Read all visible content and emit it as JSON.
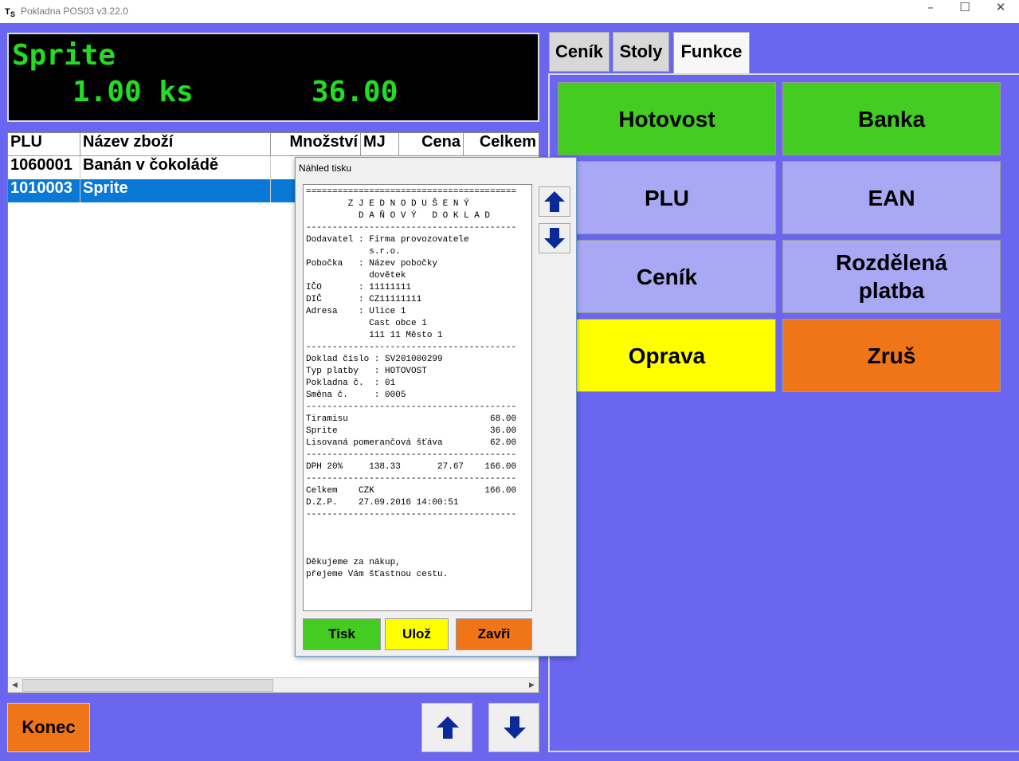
{
  "window": {
    "title": "Pokladna POS03 v3.22.0",
    "icon": "app-icon"
  },
  "display": {
    "item": "Sprite",
    "quantity": "1.00 ks",
    "price": "36.00"
  },
  "table": {
    "columns": [
      "PLU",
      "Název zboží",
      "Množství",
      "MJ",
      "Cena",
      "Celkem"
    ],
    "rows": [
      [
        "1060001",
        "Banán v čokoládě",
        "",
        "",
        "",
        ""
      ],
      [
        "1010003",
        "Sprite",
        "",
        "",
        "",
        ""
      ]
    ],
    "selected_row": 1
  },
  "buttons": {
    "konec": "Konec",
    "up_icon": "arrow-up-icon",
    "down_icon": "arrow-down-icon"
  },
  "tabs": [
    "Ceník",
    "Stoly",
    "Funkce"
  ],
  "active_tab": "Funkce",
  "functions": [
    {
      "label": "Hotovost",
      "color": "#44cc22"
    },
    {
      "label": "Banka",
      "color": "#44cc22"
    },
    {
      "label": "PLU",
      "color": "#a8a8f5"
    },
    {
      "label": "EAN",
      "color": "#a8a8f5"
    },
    {
      "label": "Ceník",
      "color": "#a8a8f5"
    },
    {
      "label": "Rozdělená platba",
      "color": "#a8a8f5"
    },
    {
      "label": "Oprava",
      "color": "#ffff00"
    },
    {
      "label": "Zruš",
      "color": "#f07518"
    }
  ],
  "dialog": {
    "title": "Náhled tisku",
    "receipt": "========================================\n        Z J E D N O D U Š E N Ý\n          D A Ň O V Ý   D O K L A D\n----------------------------------------\nDodavatel : Firma provozovatele\n            s.r.o.\nPobočka   : Název pobočky\n            dovětek\nIČO       : 11111111\nDIČ       : CZ11111111\nAdresa    : Ulice 1\n            Cast obce 1\n            111 11 Město 1\n----------------------------------------\nDoklad číslo : SV201000299\nTyp platby   : HOTOVOST\nPokladna č.  : 01\nSměna č.     : 0005\n----------------------------------------\nTiramisu                           68.00\nSprite                             36.00\nLisovaná pomerančová šťáva         62.00\n----------------------------------------\nDPH 20%     138.33       27.67    166.00\n----------------------------------------\nCelkem    CZK                     166.00\nD.Z.P.    27.09.2016 14:00:51\n----------------------------------------\n\n\n\nDěkujeme za nákup,\npřejeme Vám šťastnou cestu.\n\n\n\n\n----------------------------------------",
    "buttons": [
      {
        "label": "Tisk",
        "color": "#44cc22"
      },
      {
        "label": "Ulož",
        "color": "#ffff00"
      },
      {
        "label": "Zavři",
        "color": "#f07518"
      }
    ]
  }
}
